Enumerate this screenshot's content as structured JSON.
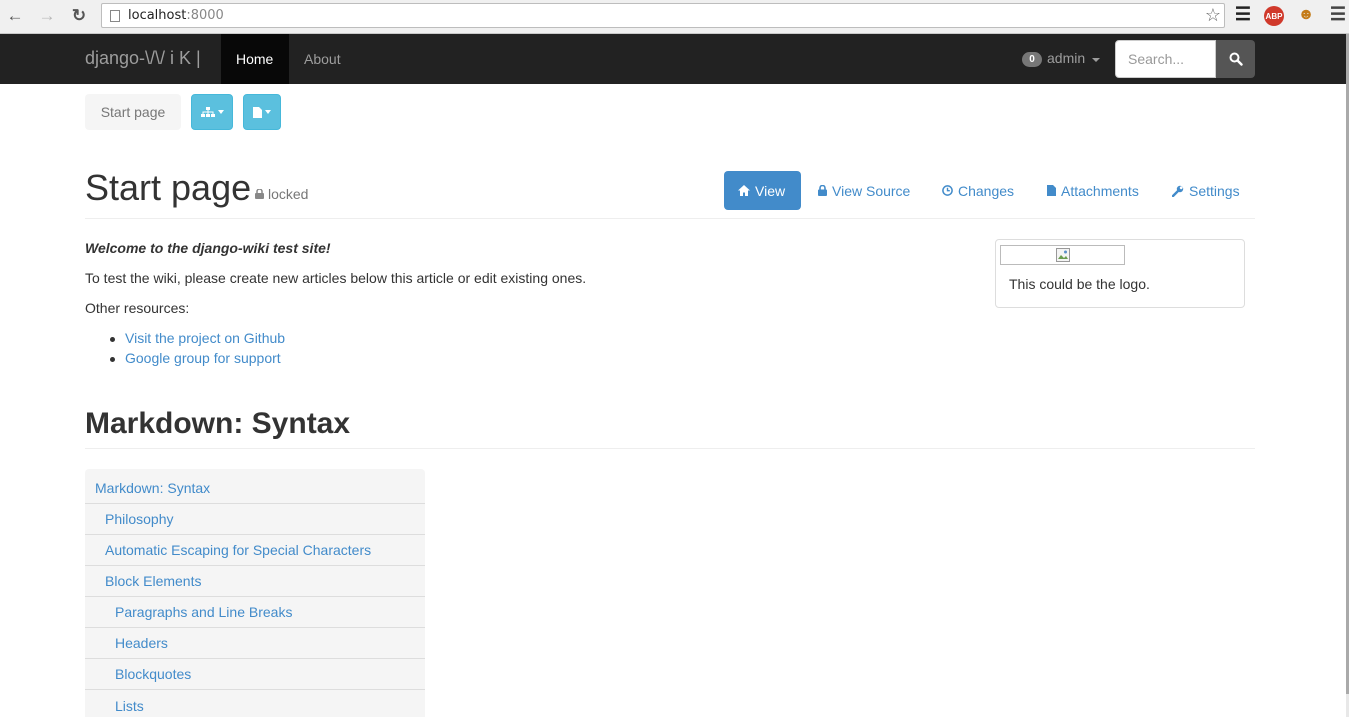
{
  "browser": {
    "url_host": "localhost",
    "url_port": ":8000",
    "abp_label": "ABP"
  },
  "navbar": {
    "brand": "django-\\/\\/ i K |",
    "items": [
      {
        "label": "Home",
        "active": true
      },
      {
        "label": "About",
        "active": false
      }
    ],
    "user": {
      "badge": "0",
      "name": "admin"
    },
    "search_placeholder": "Search..."
  },
  "toolbar": {
    "breadcrumb": "Start page"
  },
  "article": {
    "title": "Start page",
    "locked_label": "locked",
    "tabs": [
      {
        "label": "View",
        "icon": "home-icon",
        "active": true
      },
      {
        "label": "View Source",
        "icon": "lock-icon",
        "active": false
      },
      {
        "label": "Changes",
        "icon": "clock-icon",
        "active": false
      },
      {
        "label": "Attachments",
        "icon": "file-icon",
        "active": false
      },
      {
        "label": "Settings",
        "icon": "wrench-icon",
        "active": false
      }
    ],
    "welcome": "Welcome to the django-wiki test site!",
    "intro": "To test the wiki, please create new articles below this article or edit existing ones.",
    "resources_label": "Other resources:",
    "links": [
      "Visit the project on Github",
      "Google group for support"
    ],
    "logo_caption": "This could be the logo."
  },
  "section": {
    "title": "Markdown: Syntax",
    "toc": [
      {
        "label": "Markdown: Syntax",
        "level": 0
      },
      {
        "label": "Philosophy",
        "level": 1
      },
      {
        "label": "Automatic Escaping for Special Characters",
        "level": 1
      },
      {
        "label": "Block Elements",
        "level": 1
      },
      {
        "label": "Paragraphs and Line Breaks",
        "level": 2
      },
      {
        "label": "Headers",
        "level": 2
      },
      {
        "label": "Blockquotes",
        "level": 2
      },
      {
        "label": "Lists",
        "level": 2
      }
    ]
  },
  "colors": {
    "navbar_bg": "#222222",
    "link": "#428bca",
    "info_button": "#5bc0de",
    "primary": "#428bca"
  }
}
